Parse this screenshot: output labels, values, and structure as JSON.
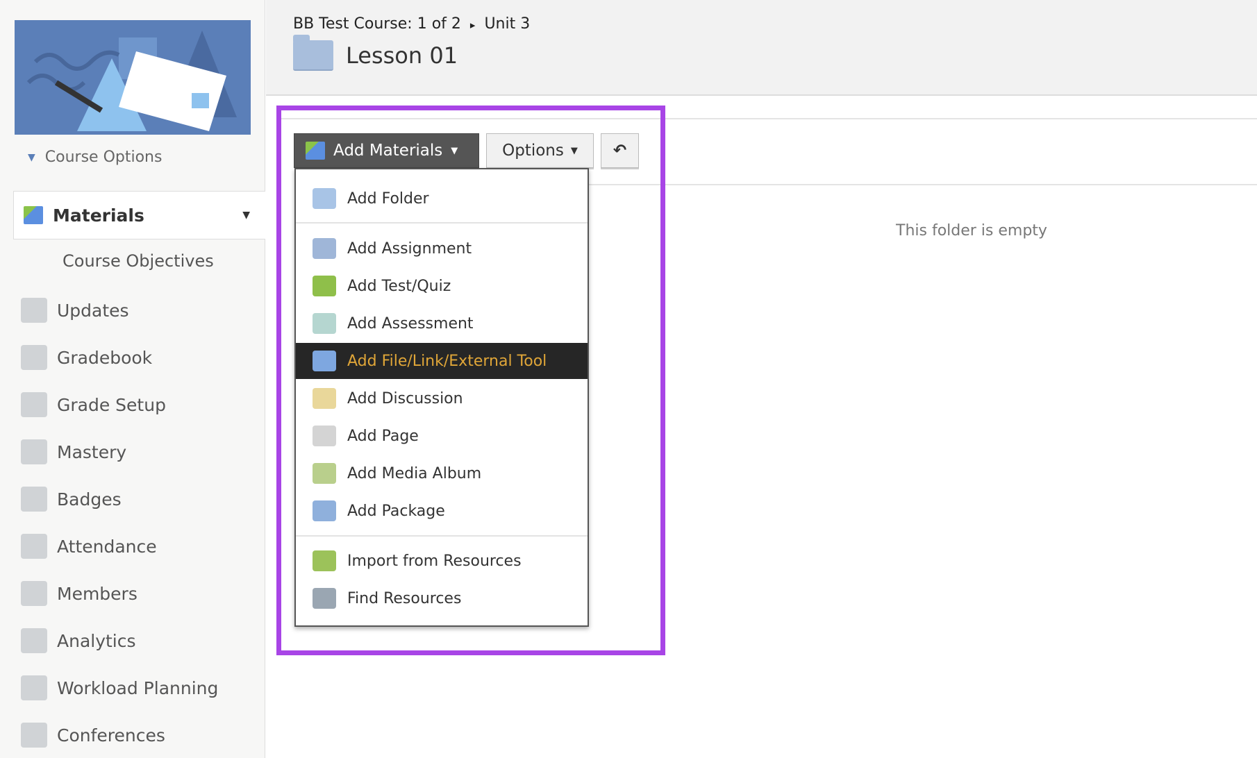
{
  "sidebar": {
    "course_options": "Course Options",
    "materials": "Materials",
    "sub_item": "Course Objectives",
    "items": [
      {
        "label": "Updates",
        "icon": "updates-icon"
      },
      {
        "label": "Gradebook",
        "icon": "gradebook-icon"
      },
      {
        "label": "Grade Setup",
        "icon": "grade-setup-icon"
      },
      {
        "label": "Mastery",
        "icon": "mastery-icon"
      },
      {
        "label": "Badges",
        "icon": "badge-star-icon"
      },
      {
        "label": "Attendance",
        "icon": "attendance-icon"
      },
      {
        "label": "Members",
        "icon": "members-icon"
      },
      {
        "label": "Analytics",
        "icon": "analytics-pie-icon"
      },
      {
        "label": "Workload Planning",
        "icon": "workload-icon"
      },
      {
        "label": "Conferences",
        "icon": "conferences-icon"
      }
    ]
  },
  "header": {
    "breadcrumb_course": "BB Test Course: 1 of 2",
    "breadcrumb_sep": "▸",
    "breadcrumb_unit": "Unit 3",
    "title": "Lesson 01"
  },
  "toolbar": {
    "add_materials": "Add Materials",
    "options": "Options",
    "back": "↶",
    "caret": "▼"
  },
  "menu": [
    {
      "label": "Add Folder",
      "color": "#a8c4e6"
    },
    {
      "label": "Add Assignment",
      "color": "#9fb6d8"
    },
    {
      "label": "Add Test/Quiz",
      "color": "#8fbf4a"
    },
    {
      "label": "Add Assessment",
      "color": "#b5d6d0"
    },
    {
      "label": "Add File/Link/External Tool",
      "color": "#7ea7e0"
    },
    {
      "label": "Add Discussion",
      "color": "#e9d79a"
    },
    {
      "label": "Add Page",
      "color": "#d4d4d4"
    },
    {
      "label": "Add Media Album",
      "color": "#b9cf8c"
    },
    {
      "label": "Add Package",
      "color": "#8fb0dc"
    },
    {
      "label": "Import from Resources",
      "color": "#9cc25a"
    },
    {
      "label": "Find Resources",
      "color": "#9aa6b2"
    }
  ],
  "selected_menu_item": "Add File/Link/External Tool",
  "main": {
    "empty_message": "This folder is empty"
  },
  "colors": {
    "highlight": "#a845e6",
    "selected_text": "#e0a638",
    "selected_bg": "#262626"
  }
}
